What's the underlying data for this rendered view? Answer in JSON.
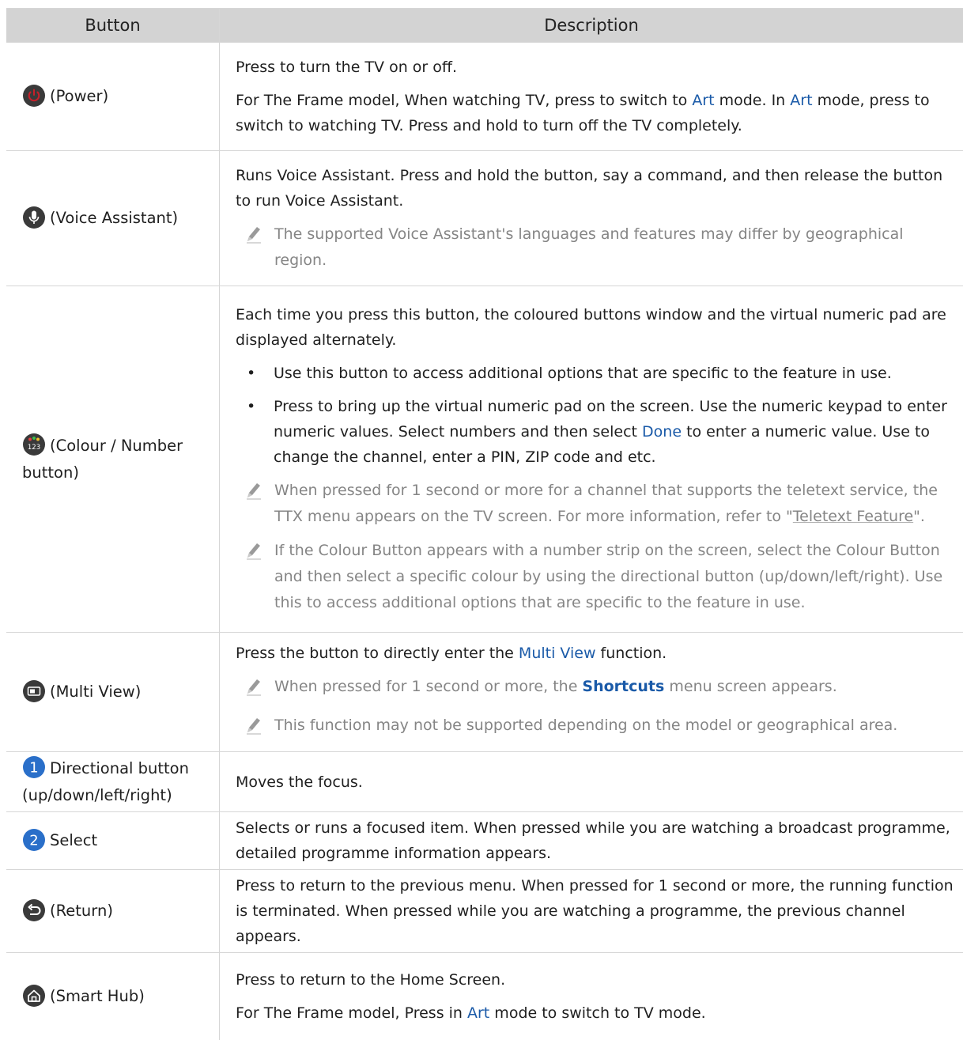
{
  "header": {
    "col_button": "Button",
    "col_description": "Description"
  },
  "rows": [
    {
      "button": "(Power)",
      "icon": "power-icon",
      "p1": "Press to turn the TV on or off.",
      "p2a": "For The Frame model, When watching TV, press to switch to ",
      "p2_link1": "Art",
      "p2b": " mode. In ",
      "p2_link2": "Art",
      "p2c": " mode, press to switch to watching TV. Press and hold to turn off the TV completely."
    },
    {
      "button": "(Voice Assistant)",
      "icon": "microphone-icon",
      "p1": "Runs Voice Assistant. Press and hold the button, say a command, and then release the button to run Voice Assistant.",
      "note1": "The supported Voice Assistant's languages and features may differ by geographical region."
    },
    {
      "button": "(Colour / Number button)",
      "icon": "colour-number-icon",
      "icon_text": "123",
      "p1": "Each time you press this button, the coloured buttons window and the virtual numeric pad are displayed alternately.",
      "bullet1": "Use this button to access additional options that are specific to the feature in use.",
      "bullet2a": "Press to bring up the virtual numeric pad on the screen. Use the numeric keypad to enter numeric values. Select numbers and then select ",
      "bullet2_link": "Done",
      "bullet2b": " to enter a numeric value. Use to change the channel, enter a PIN, ZIP code and etc.",
      "note1a": "When pressed for 1 second or more for a channel that supports the teletext service, the TTX menu appears on the TV screen. For more information, refer to \"",
      "note1_link": "Teletext Feature",
      "note1b": "\".",
      "note2": "If the Colour Button appears with a number strip on the screen, select the Colour Button and then select a specific colour by using the directional button (up/down/left/right). Use this to access additional options that are specific to the feature in use."
    },
    {
      "button": "(Multi View)",
      "icon": "multi-view-icon",
      "p1a": "Press the button to directly enter the ",
      "p1_link": "Multi View",
      "p1b": " function.",
      "note1a": "When pressed for 1 second or more, the ",
      "note1_link": "Shortcuts",
      "note1b": " menu screen appears.",
      "note2": "This function may not be supported depending on the model or geographical area."
    },
    {
      "button": "Directional button (up/down/left/right)",
      "badge": "1",
      "p1": "Moves the focus."
    },
    {
      "button": "Select",
      "badge": "2",
      "p1": "Selects or runs a focused item. When pressed while you are watching a broadcast programme, detailed programme information appears."
    },
    {
      "button": "(Return)",
      "icon": "return-icon",
      "p1": "Press to return to the previous menu. When pressed for 1 second or more, the running function is terminated. When pressed while you are watching a programme, the previous channel appears."
    },
    {
      "button": "(Smart Hub)",
      "icon": "home-icon",
      "p1": "Press to return to the Home Screen.",
      "p2a": "For The Frame model, Press in ",
      "p2_link": "Art",
      "p2b": " mode to switch to TV mode."
    }
  ],
  "colors": {
    "link": "#1a5aa8",
    "note": "#858585",
    "header_bg": "#d3d3d3",
    "badge": "#2a6fc9",
    "icon_bg": "#3a3a3a"
  }
}
